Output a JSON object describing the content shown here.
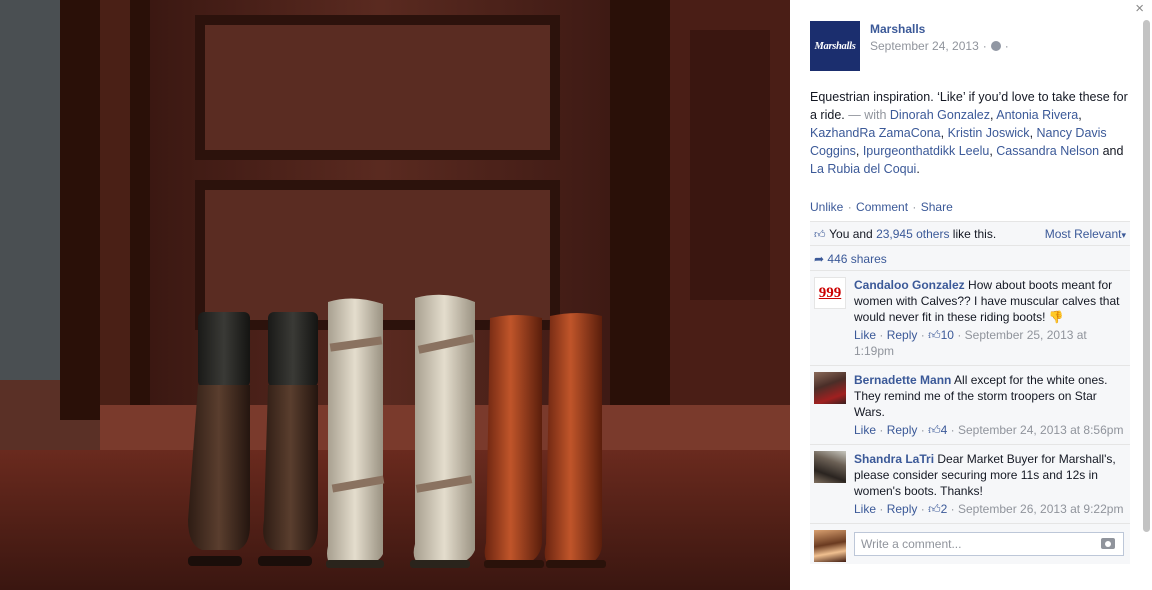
{
  "close_symbol": "×",
  "photo": {
    "description_icon": "photo-of-riding-boots"
  },
  "post": {
    "page_name": "Marshalls",
    "logo_text": "Marshalls",
    "date": "September 24, 2013",
    "meta_sep": "·",
    "privacy_icon": "globe-icon",
    "text_main": "Equestrian inspiration. ‘Like’ if you’d love to take these for a ride.",
    "with_prefix": " — with ",
    "tagged": [
      "Dinorah Gonzalez",
      "Antonia Rivera",
      "KazhandRa ZamaCona",
      "Kristin Joswick",
      "Nancy Davis Coggins",
      "Ipurgeonthatdikk Leelu",
      "Cassandra Nelson",
      "La Rubia del Coqui"
    ],
    "tag_sep": ", ",
    "tag_and": " and ",
    "tag_end": "."
  },
  "actions": {
    "unlike": "Unlike",
    "comment": "Comment",
    "share": "Share",
    "sep": "·"
  },
  "likes": {
    "you_and": "You and ",
    "others": "23,945 others",
    "suffix": " like this.",
    "sort_label": "Most Relevant",
    "sort_caret": "▾"
  },
  "shares": {
    "label": "446 shares"
  },
  "comments": [
    {
      "author": "Candaloo Gonzalez",
      "avatar_text": "999",
      "text": "How about boots meant for women with Calves?? I have muscular calves that would never fit in these riding boots! 👎",
      "like": "Like",
      "reply": "Reply",
      "likes": "10",
      "time": "September 25, 2013 at 1:19pm"
    },
    {
      "author": "Bernadette Mann",
      "avatar_text": "",
      "text": "All except for the white ones. They remind me of the storm troopers on Star Wars.",
      "like": "Like",
      "reply": "Reply",
      "likes": "4",
      "time": "September 24, 2013 at 8:56pm"
    },
    {
      "author": "Shandra LaTri",
      "avatar_text": "",
      "text": "Dear Market Buyer for Marshall's, please consider securing more 11s and 12s in women's boots. Thanks!",
      "like": "Like",
      "reply": "Reply",
      "likes": "2",
      "time": "September 26, 2013 at 9:22pm"
    }
  ],
  "write_comment": {
    "placeholder": "Write a comment..."
  },
  "colors": {
    "link": "#3b5998",
    "muted": "#90949c",
    "ufi_bg": "#f6f7f9",
    "logo_bg": "#1b2e6e"
  }
}
